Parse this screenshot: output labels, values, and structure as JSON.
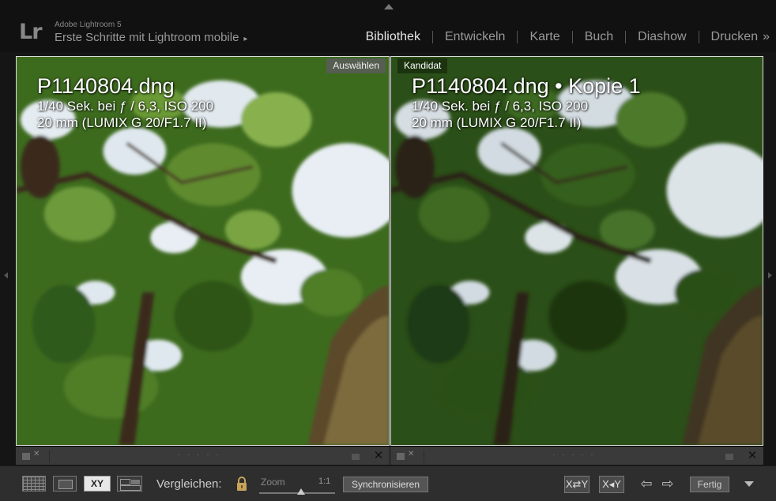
{
  "header": {
    "app_name": "Adobe Lightroom 5",
    "catalog_title": "Erste Schritte mit Lightroom mobile",
    "catalog_arrow": "▸",
    "logo": "Lr",
    "modules": [
      {
        "label": "Bibliothek",
        "active": true
      },
      {
        "label": "Entwickeln",
        "active": false
      },
      {
        "label": "Karte",
        "active": false
      },
      {
        "label": "Buch",
        "active": false
      },
      {
        "label": "Diashow",
        "active": false
      },
      {
        "label": "Drucken",
        "active": false
      }
    ],
    "more_modules": "»"
  },
  "select_pane": {
    "tag": "Auswählen",
    "filename": "P1140804.dng",
    "exposure": "1/40 Sek. bei ƒ / 6,3, ISO 200",
    "lens": "20 mm (LUMIX G 20/F1.7 II)",
    "toolbar_close": "✕"
  },
  "candidate_pane": {
    "tag": "Kandidat",
    "filename": "P1140804.dng • Kopie 1",
    "exposure": "1/40 Sek. bei ƒ / 6,3, ISO 200",
    "lens": "20 mm (LUMIX G 20/F1.7 II)",
    "toolbar_close": "✕"
  },
  "pane_toolbar": {
    "flag_x": "✕",
    "rating_dots": "· · · · ·"
  },
  "toolbar": {
    "compare_view_label": "XY",
    "compare_label": "Vergleichen:",
    "zoom_label": "Zoom",
    "zoom_ratio": "1:1",
    "zoom_level": 0.55,
    "sync_button": "Synchronisieren",
    "swap_button": "X⇄Y",
    "make_select_button": "X◂Y",
    "prev_arrow": "⇦",
    "next_arrow": "⇨",
    "done_button": "Fertig"
  },
  "colors": {
    "background": "#000000",
    "panel": "#2e2e2e",
    "active_module": "#e6e6e6",
    "inactive_module": "#999999",
    "foliage": "#3d6b1e",
    "sky": "#e8eef3"
  },
  "icons": [
    "top-panel-arrow",
    "left-panel-arrow",
    "right-panel-arrow",
    "flag-icon",
    "grid-icon",
    "loupe-icon",
    "compare-icon",
    "survey-icon",
    "lock-icon",
    "menu-chevron-icon"
  ]
}
